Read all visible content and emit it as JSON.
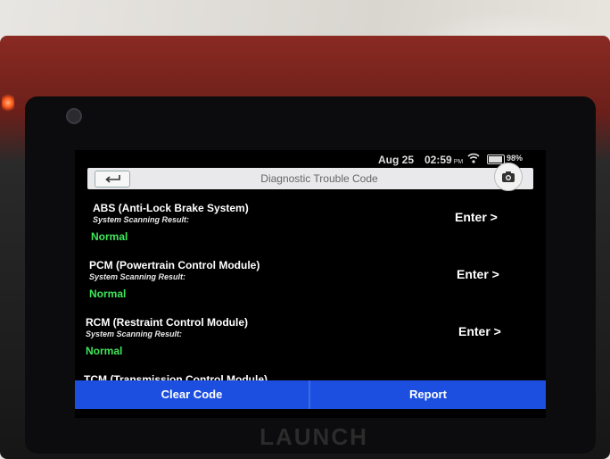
{
  "status_bar": {
    "date": "Aug 25",
    "time": "02:59",
    "ampm": "PM",
    "battery": "98%"
  },
  "header": {
    "title": "Diagnostic Trouble Code",
    "back_icon": "back-arrow-icon",
    "camera_icon": "camera-icon"
  },
  "systems": [
    {
      "name": "ABS (Anti-Lock Brake System)",
      "label": "System Scanning Result:",
      "status": "Normal",
      "action": "Enter >"
    },
    {
      "name": "PCM (Powertrain Control Module)",
      "label": "System Scanning Result:",
      "status": "Normal",
      "action": "Enter >"
    },
    {
      "name": "RCM (Restraint Control Module)",
      "label": "System Scanning Result:",
      "status": "Normal",
      "action": "Enter >"
    },
    {
      "name": "TCM (Transmission Control Module)"
    }
  ],
  "actions": {
    "clear_code": "Clear Code",
    "report": "Report"
  },
  "device": {
    "brand": "LAUNCH"
  },
  "colors": {
    "status_normal": "#3ee65a",
    "action_bar": "#1c4fe0"
  }
}
